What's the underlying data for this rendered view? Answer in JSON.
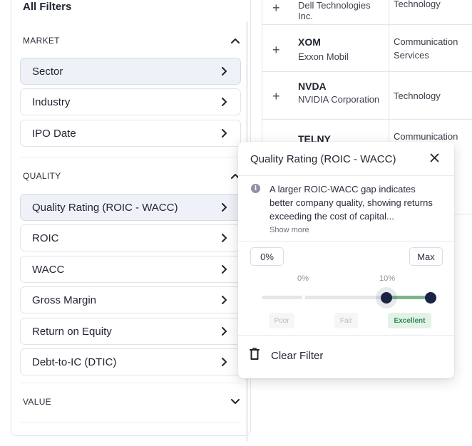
{
  "filters": {
    "title": "All Filters",
    "sections": {
      "market": {
        "label": "MARKET",
        "items": [
          "Sector",
          "Industry",
          "IPO Date"
        ]
      },
      "quality": {
        "label": "QUALITY",
        "items": [
          "Quality Rating (ROIC - WACC)",
          "ROIC",
          "WACC",
          "Gross Margin",
          "Return on Equity",
          "Debt-to-IC (DTIC)"
        ]
      },
      "value": {
        "label": "VALUE"
      }
    }
  },
  "table": {
    "rows": [
      {
        "ticker": "",
        "company": "Dell Technologies Inc.",
        "sector": "Technology"
      },
      {
        "ticker": "XOM",
        "company": "Exxon Mobil",
        "sector": "Communication Services"
      },
      {
        "ticker": "NVDA",
        "company": "NVIDIA Corporation",
        "sector": "Technology"
      },
      {
        "ticker": "TELNY",
        "company": "",
        "sector": "Communication"
      }
    ]
  },
  "popover": {
    "title": "Quality Rating (ROIC - WACC)",
    "description": "A larger ROIC-WACC gap indicates better company quality, showing returns exceeding the cost of capital...",
    "show_more": "Show more",
    "min_value": "0%",
    "max_value": "Max",
    "tick_labels": [
      "0%",
      "10%"
    ],
    "grades": [
      "Poor",
      "Fair",
      "Excellent"
    ],
    "selected_grade": "Excellent",
    "clear_label": "Clear Filter",
    "colors": {
      "accent_green": "#7fb38f",
      "handle": "#1b2344",
      "excellent_text": "#2f8a52"
    }
  }
}
